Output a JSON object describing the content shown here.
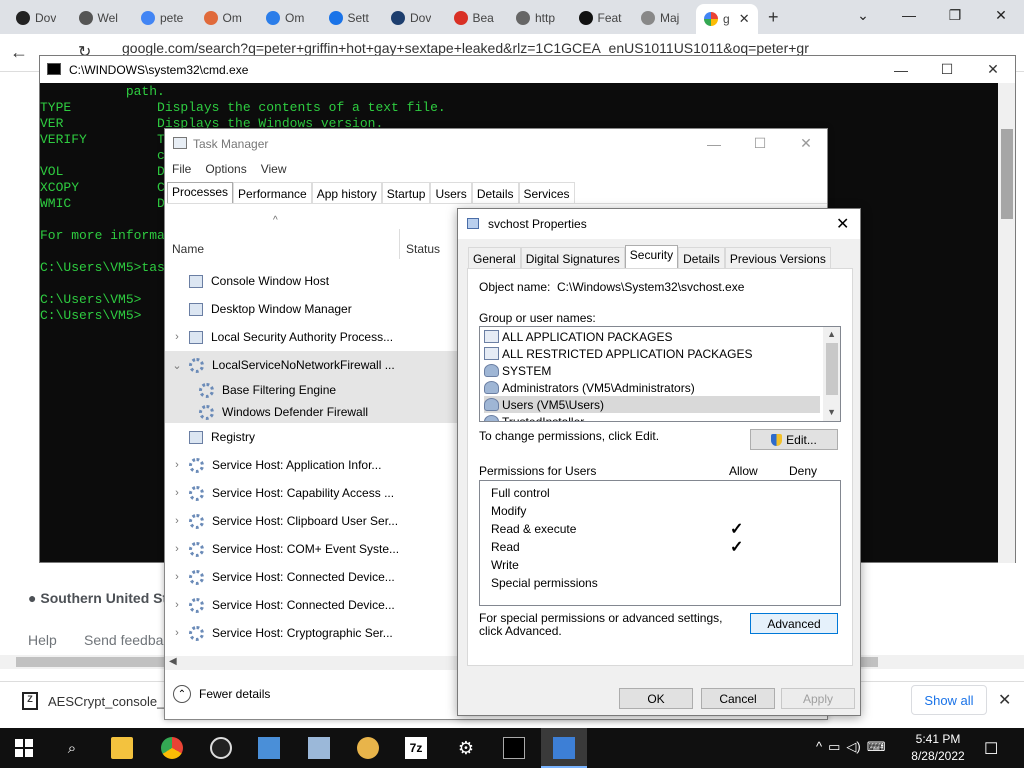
{
  "browser": {
    "tabs": [
      {
        "label": "Dov",
        "color": "#222222"
      },
      {
        "label": "Wel",
        "color": "#555555"
      },
      {
        "label": "pete",
        "color": "#4285f4"
      },
      {
        "label": "Om",
        "color": "#e06a3b"
      },
      {
        "label": "Om",
        "color": "#2b7de9"
      },
      {
        "label": "Sett",
        "color": "#1a73e8"
      },
      {
        "label": "Dov",
        "color": "#1d3e6e"
      },
      {
        "label": "Bea",
        "color": "#d93025"
      },
      {
        "label": "http",
        "color": "#666666"
      },
      {
        "label": "Feat",
        "color": "#111111"
      },
      {
        "label": "Maj",
        "color": "#888888"
      }
    ],
    "active_tab": "g",
    "new_tab_label": "+",
    "url": "google.com/search?q=peter+griffin+hot+gay+sextape+leaked&rlz=1C1GCEA_enUS1011US1011&oq=peter+gr",
    "location": "Southern United Sta",
    "help": "Help",
    "feedback": "Send feedba",
    "download_name": "AESCrypt_console_...",
    "show_all": "Show all"
  },
  "cmd": {
    "title": "C:\\WINDOWS\\system32\\cmd.exe",
    "lines": [
      "           path.",
      "TYPE           Displays the contents of a text file.",
      "VER            Displays the Windows version.",
      "VERIFY         T",
      "               c",
      "VOL            D",
      "XCOPY          C",
      "WMIC           D",
      "",
      "For more informa",
      "",
      "C:\\Users\\VM5>tas",
      "",
      "C:\\Users\\VM5>",
      "C:\\Users\\VM5>"
    ]
  },
  "taskmgr": {
    "title": "Task Manager",
    "menu": [
      "File",
      "Options",
      "View"
    ],
    "tabs": [
      "Processes",
      "Performance",
      "App history",
      "Startup",
      "Users",
      "Details",
      "Services"
    ],
    "columns": {
      "name": "Name",
      "status": "Status"
    },
    "processes": [
      {
        "name": "Console Window Host",
        "expandable": false
      },
      {
        "name": "Desktop Window Manager",
        "expandable": false
      },
      {
        "name": "Local Security Authority Process...",
        "expandable": true
      },
      {
        "name": "LocalServiceNoNetworkFirewall ...",
        "expandable": true,
        "expanded": true
      },
      {
        "name": "Base Filtering Engine",
        "child": true
      },
      {
        "name": "Windows Defender Firewall",
        "child": true
      },
      {
        "name": "Registry",
        "expandable": false
      },
      {
        "name": "Service Host: Application Infor...",
        "expandable": true
      },
      {
        "name": "Service Host: Capability Access ...",
        "expandable": true
      },
      {
        "name": "Service Host: Clipboard User Ser...",
        "expandable": true
      },
      {
        "name": "Service Host: COM+ Event Syste...",
        "expandable": true
      },
      {
        "name": "Service Host: Connected Device...",
        "expandable": true
      },
      {
        "name": "Service Host: Connected Device...",
        "expandable": true
      },
      {
        "name": "Service Host: Cryptographic Ser...",
        "expandable": true
      }
    ],
    "fewer_details": "Fewer details"
  },
  "props": {
    "title": "svchost Properties",
    "tabs": [
      "General",
      "Digital Signatures",
      "Security",
      "Details",
      "Previous Versions"
    ],
    "active_tab": "Security",
    "object_name_label": "Object name:",
    "object_name": "C:\\Windows\\System32\\svchost.exe",
    "group_label": "Group or user names:",
    "users": [
      {
        "name": "ALL APPLICATION PACKAGES",
        "kind": "group"
      },
      {
        "name": "ALL RESTRICTED APPLICATION PACKAGES",
        "kind": "group"
      },
      {
        "name": "SYSTEM",
        "kind": "user"
      },
      {
        "name": "Administrators (VM5\\Administrators)",
        "kind": "user"
      },
      {
        "name": "Users (VM5\\Users)",
        "kind": "user",
        "selected": true
      },
      {
        "name": "TrustedInstaller",
        "kind": "user"
      }
    ],
    "change_label": "To change permissions, click Edit.",
    "edit_label": "Edit...",
    "permissions_for": "Permissions for Users",
    "allow_label": "Allow",
    "deny_label": "Deny",
    "permissions": [
      {
        "name": "Full control",
        "allow": false,
        "deny": false
      },
      {
        "name": "Modify",
        "allow": false,
        "deny": false
      },
      {
        "name": "Read & execute",
        "allow": true,
        "deny": false
      },
      {
        "name": "Read",
        "allow": true,
        "deny": false
      },
      {
        "name": "Write",
        "allow": false,
        "deny": false
      },
      {
        "name": "Special permissions",
        "allow": false,
        "deny": false
      }
    ],
    "special_text": "For special permissions or advanced settings, click Advanced.",
    "advanced_label": "Advanced",
    "ok_label": "OK",
    "cancel_label": "Cancel",
    "apply_label": "Apply"
  },
  "taskbar": {
    "time": "5:41 PM",
    "date": "8/28/2022",
    "apps": [
      "start-icon",
      "search-icon",
      "file-explorer-icon",
      "chrome-icon",
      "obs-icon",
      "control-panel-icon",
      "network-icon",
      "paint-icon",
      "7zip-icon",
      "settings-icon",
      "cmd-icon",
      "task-manager-icon"
    ],
    "sevenzip_label": "7z"
  }
}
